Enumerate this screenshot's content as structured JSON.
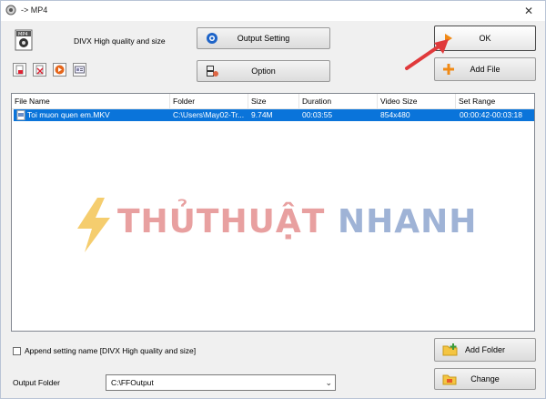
{
  "window": {
    "title": "-> MP4",
    "close_glyph": "✕"
  },
  "profile": {
    "label": "DIVX High quality and size",
    "icon": "mp4-file-icon"
  },
  "buttons": {
    "output_setting": "Output Setting",
    "option": "Option",
    "ok": "OK",
    "add_file": "Add File",
    "add_folder": "Add Folder",
    "change": "Change"
  },
  "toolbar_icons": [
    "remove-icon",
    "clear-icon",
    "play-icon",
    "info-icon"
  ],
  "list": {
    "columns": [
      "File Name",
      "Folder",
      "Size",
      "Duration",
      "Video Size",
      "Set Range"
    ],
    "rows": [
      {
        "file_name": "Toi muon quen em.MKV",
        "folder": "C:\\Users\\May02-Tr...",
        "size": "9.74M",
        "duration": "00:03:55",
        "video_size": "854x480",
        "set_range": "00:00:42-00:03:18"
      }
    ]
  },
  "watermark": {
    "text_a": "THỦTHUẬT",
    "text_b": "NHANH"
  },
  "append_setting": {
    "label": "Append setting name [DIVX High quality and size]",
    "checked": false
  },
  "output_folder": {
    "label": "Output Folder",
    "value": "C:\\FFOutput"
  },
  "colors": {
    "selection": "#0a74da",
    "arrow": "#e0393b",
    "watermark_red": "#e8a0a0",
    "watermark_blue": "#9fb3d6"
  }
}
